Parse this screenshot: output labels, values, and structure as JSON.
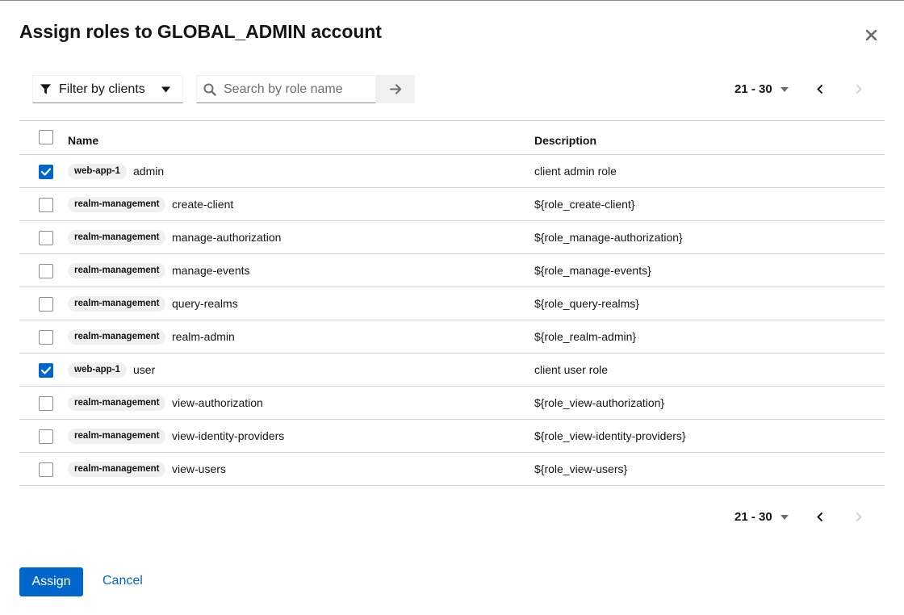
{
  "modal": {
    "title": "Assign roles to GLOBAL_ADMIN account",
    "close_icon": "close-icon"
  },
  "toolbar": {
    "filter_label": "Filter by clients",
    "filter_icon": "filter-icon",
    "search_placeholder": "Search by role name",
    "search_value": "",
    "search_icon": "search-icon",
    "search_submit_icon": "arrow-right-icon"
  },
  "pagination_top": {
    "range": "21 - 30",
    "prev_enabled": true,
    "next_enabled": false
  },
  "pagination_bottom": {
    "range": "21 - 30",
    "prev_enabled": true,
    "next_enabled": false
  },
  "table": {
    "columns": [
      "Name",
      "Description"
    ],
    "select_all_checked": false,
    "rows": [
      {
        "client": "web-app-1",
        "name": "admin",
        "description": "client admin role",
        "checked": true
      },
      {
        "client": "realm-management",
        "name": "create-client",
        "description": "${role_create-client}",
        "checked": false
      },
      {
        "client": "realm-management",
        "name": "manage-authorization",
        "description": "${role_manage-authorization}",
        "checked": false
      },
      {
        "client": "realm-management",
        "name": "manage-events",
        "description": "${role_manage-events}",
        "checked": false
      },
      {
        "client": "realm-management",
        "name": "query-realms",
        "description": "${role_query-realms}",
        "checked": false
      },
      {
        "client": "realm-management",
        "name": "realm-admin",
        "description": "${role_realm-admin}",
        "checked": false
      },
      {
        "client": "web-app-1",
        "name": "user",
        "description": "client user role",
        "checked": true
      },
      {
        "client": "realm-management",
        "name": "view-authorization",
        "description": "${role_view-authorization}",
        "checked": false
      },
      {
        "client": "realm-management",
        "name": "view-identity-providers",
        "description": "${role_view-identity-providers}",
        "checked": false
      },
      {
        "client": "realm-management",
        "name": "view-users",
        "description": "${role_view-users}",
        "checked": false
      }
    ]
  },
  "footer": {
    "assign_label": "Assign",
    "cancel_label": "Cancel"
  },
  "colors": {
    "primary": "#0066cc",
    "border": "#d2d2d2",
    "badge_bg": "#f0f0f0",
    "disabled": "#d2d2d2"
  }
}
